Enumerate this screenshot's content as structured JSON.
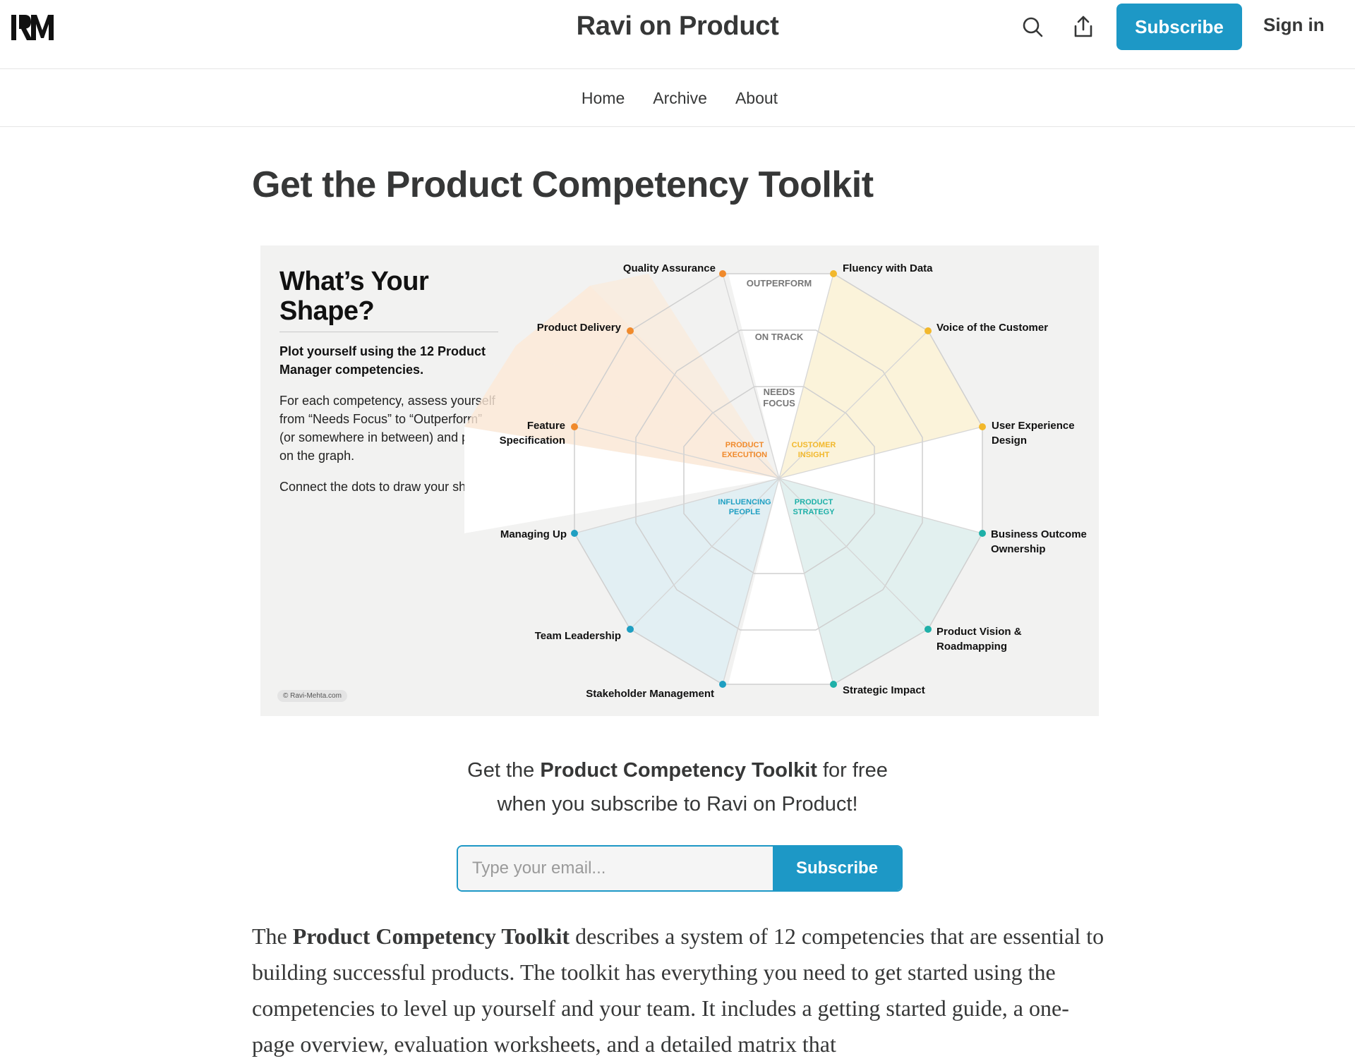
{
  "header": {
    "logo_text": "RM",
    "publication_title": "Ravi on Product",
    "search_icon": "search-icon",
    "share_icon": "share-icon",
    "subscribe_label": "Subscribe",
    "signin_label": "Sign in",
    "accent_color": "#1d98c6"
  },
  "nav": {
    "items": [
      "Home",
      "Archive",
      "About"
    ]
  },
  "post": {
    "title": "Get the Product Competency Toolkit"
  },
  "hero_image": {
    "heading": "What’s Your Shape?",
    "subheading": "Plot yourself using the 12 Product Manager competencies.",
    "paragraph1": "For each competency, assess yourself from “Needs Focus” to “Outperform” (or somewhere in between) and plot it on the graph.",
    "paragraph2": "Connect the dots to draw your shape.",
    "copyright": "© Ravi-Mehta.com",
    "levels": [
      "OUTPERFORM",
      "ON TRACK",
      "NEEDS",
      "FOCUS"
    ],
    "competencies": [
      "Quality Assurance",
      "Fluency with Data",
      "Voice of the Customer",
      "User Experience",
      "Design",
      "Business Outcome",
      "Ownership",
      "Product Vision &",
      "Roadmapping",
      "Strategic Impact",
      "Stakeholder Management",
      "Team Leadership",
      "Managing Up",
      "Feature",
      "Specification",
      "Product Delivery"
    ],
    "categories": [
      {
        "line1": "PRODUCT",
        "line2": "EXECUTION",
        "color": "#f08a2c"
      },
      {
        "line1": "CUSTOMER",
        "line2": "INSIGHT",
        "color": "#f2b82c"
      },
      {
        "line1": "PRODUCT",
        "line2": "STRATEGY",
        "color": "#1fb0a8"
      },
      {
        "line1": "INFLUENCING",
        "line2": "PEOPLE",
        "color": "#1f9fc2"
      }
    ]
  },
  "cta": {
    "prefix": "Get the ",
    "bold": "Product Competency Toolkit",
    "suffix": " for free",
    "line2": "when you subscribe to Ravi on Product!"
  },
  "form": {
    "email_placeholder": "Type your email...",
    "subscribe_label": "Subscribe"
  },
  "body": {
    "intro_prefix": "The ",
    "intro_bold": "Product Competency Toolkit",
    "intro_rest": " describes a system of 12 competencies that are essential to building successful products. The toolkit has everything you need to get started using the competencies to level up yourself and your team. It includes a getting started guide, a one-page overview, evaluation worksheets, and a detailed matrix that"
  }
}
